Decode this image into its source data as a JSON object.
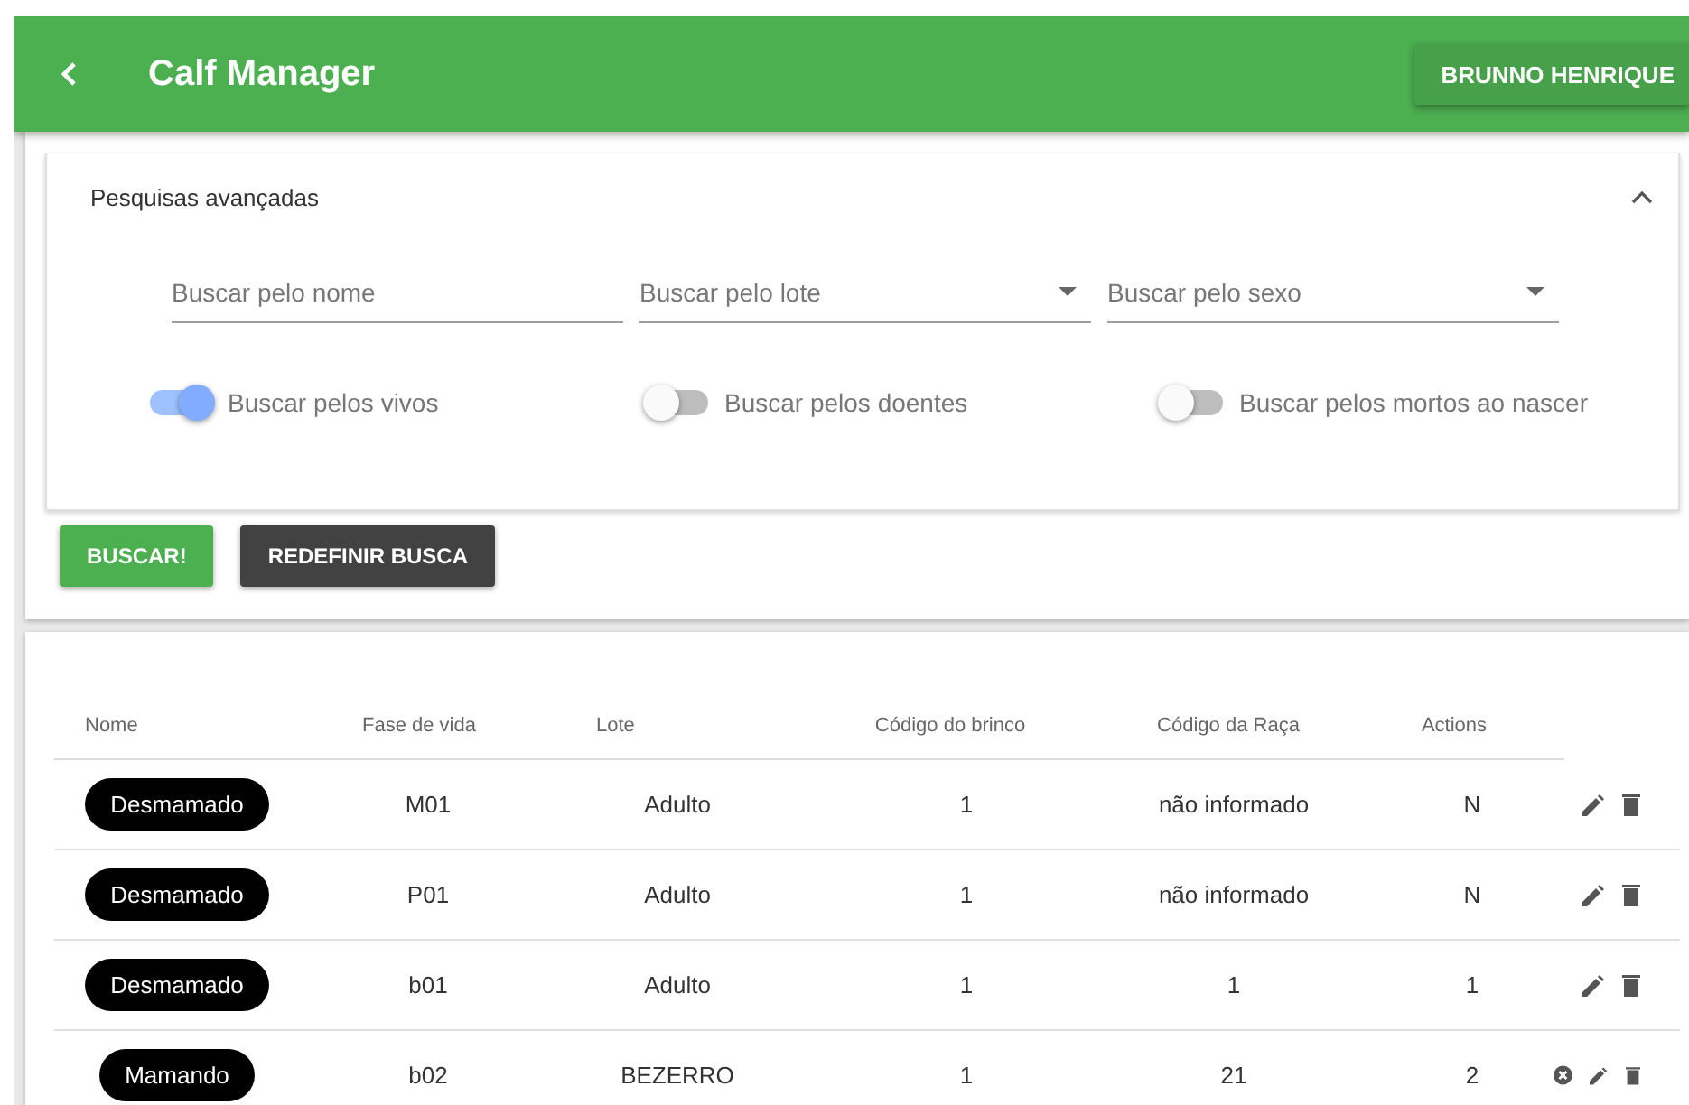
{
  "app_bar": {
    "title": "Calf Manager",
    "user_button": "BRUNNO HENRIQUE"
  },
  "search_panel": {
    "title": "Pesquisas avançadas",
    "expanded": true,
    "fields": [
      {
        "kind": "text",
        "placeholder": "Buscar pelo nome"
      },
      {
        "kind": "select",
        "placeholder": "Buscar pelo lote"
      },
      {
        "kind": "select",
        "placeholder": "Buscar pelo sexo"
      }
    ],
    "toggles": [
      {
        "label": "Buscar pelos vivos",
        "on": true
      },
      {
        "label": "Buscar pelos doentes",
        "on": false
      },
      {
        "label": "Buscar pelos mortos ao nascer",
        "on": false
      }
    ]
  },
  "buttons": [
    {
      "kind": "primary",
      "label": "BUSCAR!"
    },
    {
      "kind": "dark",
      "label": "REDEFINIR BUSCA"
    }
  ],
  "table": {
    "columns": [
      "Nome",
      "Fase de vida",
      "Lote",
      "Código do brinco",
      "Código da Raça",
      "Actions"
    ],
    "rows": [
      {
        "cells": [
          "Desmamado",
          "M01",
          "Adulto",
          "1",
          "não informado",
          "N"
        ],
        "actions": [
          {
            "kind": "edit"
          },
          {
            "kind": "delete"
          }
        ]
      },
      {
        "cells": [
          "Desmamado",
          "P01",
          "Adulto",
          "1",
          "não informado",
          "N"
        ],
        "actions": [
          {
            "kind": "edit"
          },
          {
            "kind": "delete"
          }
        ]
      },
      {
        "cells": [
          "Desmamado",
          "b01",
          "Adulto",
          "1",
          "1",
          "1"
        ],
        "actions": [
          {
            "kind": "edit"
          },
          {
            "kind": "delete"
          }
        ]
      },
      {
        "cells": [
          "Mamando",
          "b02",
          "BEZERRO",
          "1",
          "21",
          "2"
        ],
        "actions": [
          {
            "kind": "cancel"
          },
          {
            "kind": "edit"
          },
          {
            "kind": "delete"
          }
        ]
      }
    ]
  }
}
